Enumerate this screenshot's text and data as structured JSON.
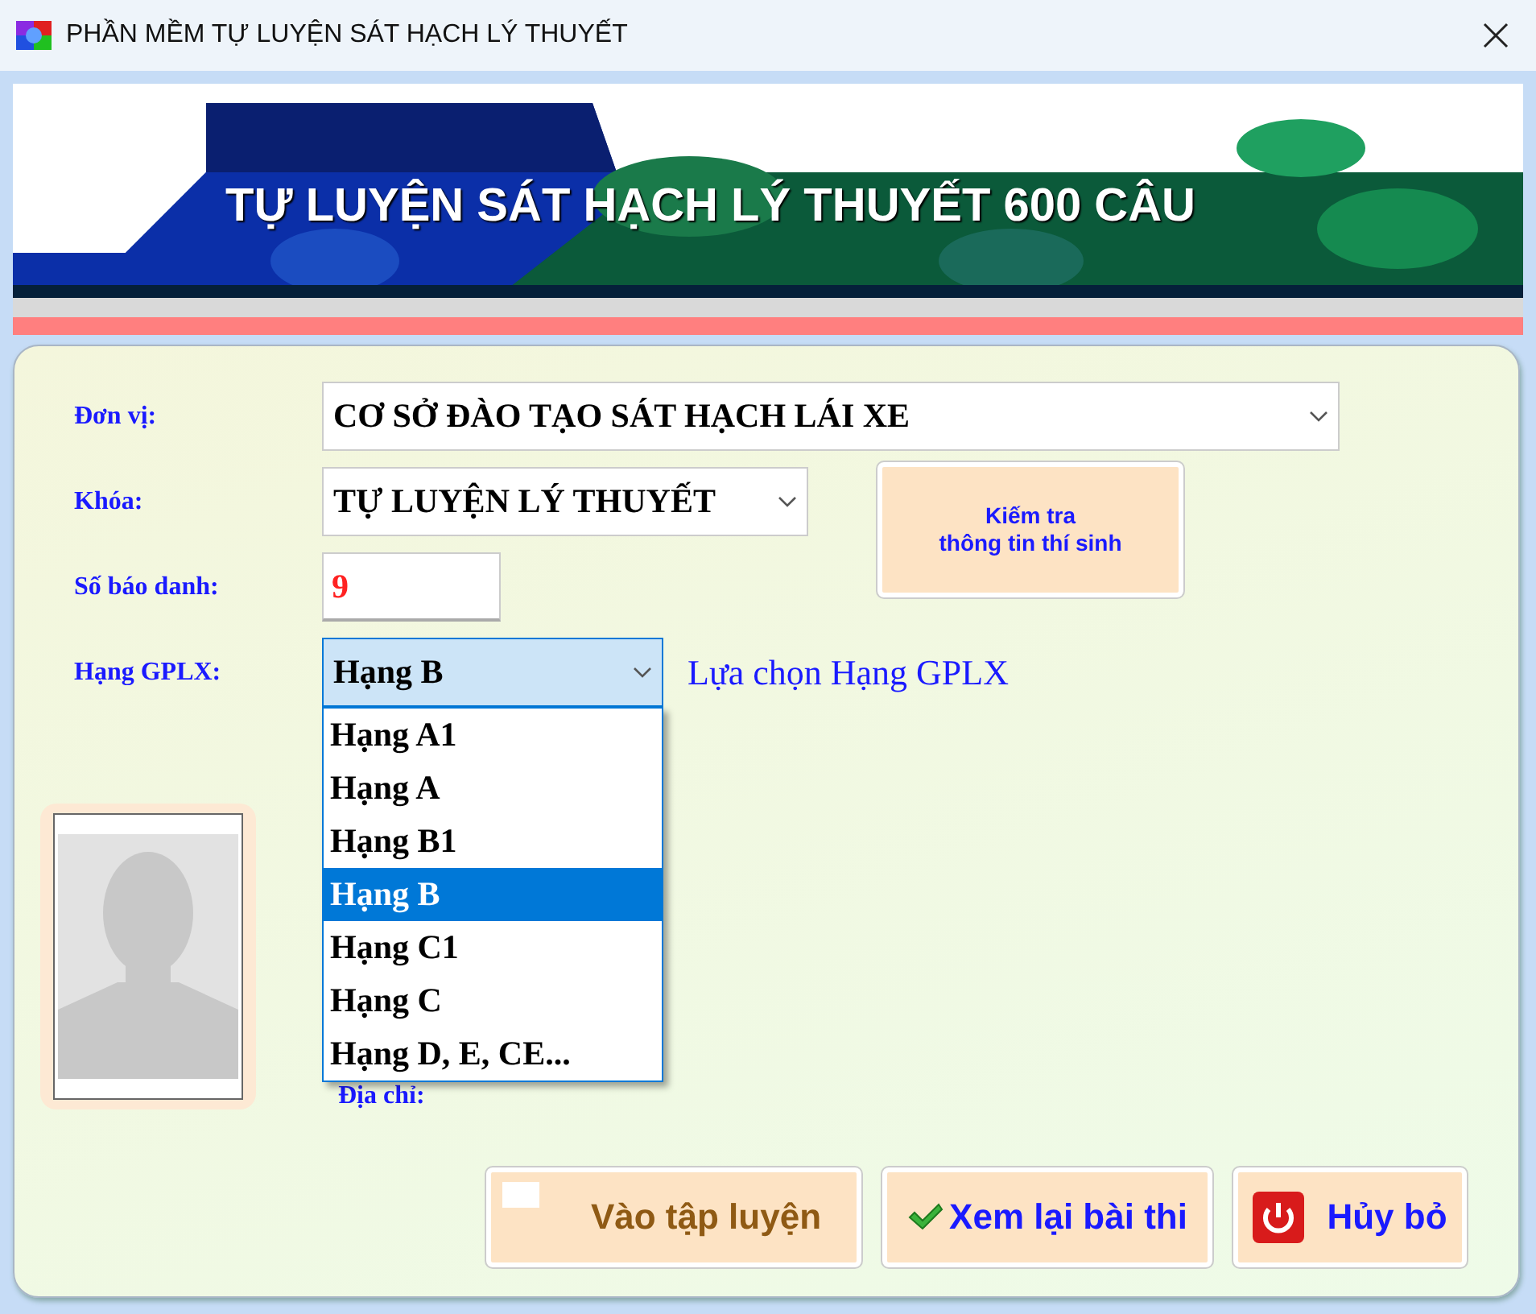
{
  "window": {
    "title": "PHẦN MỀM TỰ LUYỆN SÁT HẠCH LÝ THUYẾT"
  },
  "banner": {
    "title": "TỰ LUYỆN SÁT HẠCH LÝ THUYẾT 600 CÂU"
  },
  "fields": [
    {
      "kind": "combo",
      "label": "Đơn vị:",
      "value": "CƠ SỞ ĐÀO TẠO SÁT HẠCH LÁI XE",
      "expanded": false
    },
    {
      "kind": "combo",
      "label": "Khóa:",
      "value": "TỰ LUYỆN LÝ THUYẾT",
      "expanded": false
    },
    {
      "kind": "input",
      "label": "Số báo danh:",
      "value": "9"
    },
    {
      "kind": "combo",
      "label": "Hạng GPLX:",
      "value": "Hạng B",
      "hint": "Lựa chọn Hạng GPLX",
      "expanded": true
    }
  ],
  "check_button": {
    "lines": [
      "Kiếm tra",
      "thông tin thí sinh"
    ]
  },
  "options": [
    {
      "label": "Hạng A1",
      "selected": false
    },
    {
      "label": "Hạng A",
      "selected": false
    },
    {
      "label": "Hạng B1",
      "selected": false
    },
    {
      "label": "Hạng B",
      "selected": true
    },
    {
      "label": "Hạng C1",
      "selected": false
    },
    {
      "label": "Hạng C",
      "selected": false
    },
    {
      "label": "Hạng D, E, CE...",
      "selected": false
    }
  ],
  "address_label": "Địa chỉ:",
  "buttons": [
    {
      "kind": "start",
      "label": "Vào tập luyện"
    },
    {
      "kind": "review",
      "label": "Xem lại bài thi"
    },
    {
      "kind": "cancel",
      "label": "Hủy bỏ"
    }
  ]
}
